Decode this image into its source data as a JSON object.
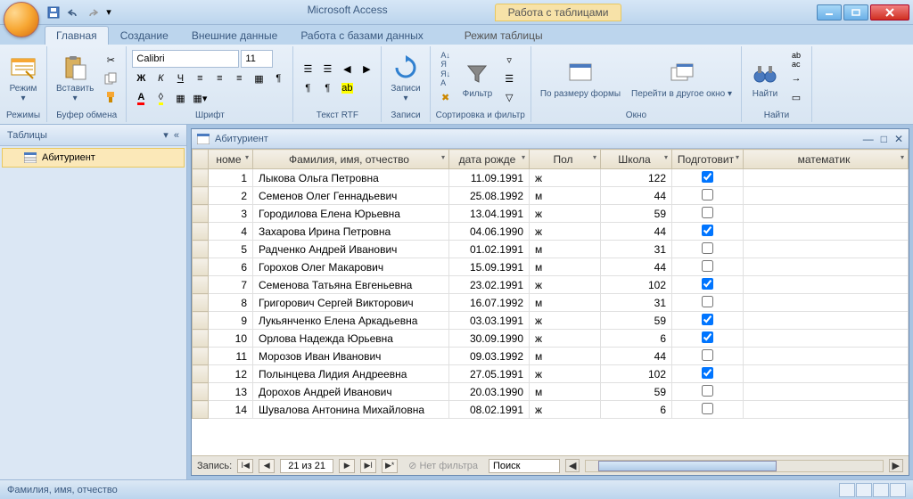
{
  "app": {
    "title": "Microsoft Access",
    "context_group": "Работа с таблицами"
  },
  "ribbon": {
    "tabs": [
      "Главная",
      "Создание",
      "Внешние данные",
      "Работа с базами данных"
    ],
    "context_tab": "Режим таблицы",
    "active": 0,
    "groups": {
      "views": {
        "label": "Режимы",
        "btn": "Режим"
      },
      "clipboard": {
        "label": "Буфер обмена",
        "paste": "Вставить"
      },
      "font": {
        "label": "Шрифт",
        "name": "Calibri",
        "size": "11"
      },
      "richtext": {
        "label": "Текст RTF"
      },
      "records": {
        "label": "Записи",
        "btn": "Записи"
      },
      "sortfilter": {
        "label": "Сортировка и фильтр",
        "filter": "Фильтр"
      },
      "window": {
        "label": "Окно",
        "fit": "По размеру формы",
        "switch": "Перейти в другое окно"
      },
      "find": {
        "label": "Найти",
        "btn": "Найти"
      }
    }
  },
  "nav": {
    "header": "Таблицы",
    "item": "Абитуриент"
  },
  "doc": {
    "title": "Абитуриент"
  },
  "columns": [
    "номе",
    "Фамилия, имя, отчество",
    "дата рожде",
    "Пол",
    "Школа",
    "Подготовит",
    "математик"
  ],
  "rows": [
    {
      "n": 1,
      "fio": "Лыкова Ольга Петровна",
      "dob": "11.09.1991",
      "sex": "ж",
      "school": 122,
      "prep": true
    },
    {
      "n": 2,
      "fio": "Семенов Олег Геннадьевич",
      "dob": "25.08.1992",
      "sex": "м",
      "school": 44,
      "prep": false
    },
    {
      "n": 3,
      "fio": "Городилова Елена Юрьевна",
      "dob": "13.04.1991",
      "sex": "ж",
      "school": 59,
      "prep": false
    },
    {
      "n": 4,
      "fio": "Захарова Ирина Петровна",
      "dob": "04.06.1990",
      "sex": "ж",
      "school": 44,
      "prep": true
    },
    {
      "n": 5,
      "fio": "Радченко Андрей Иванович",
      "dob": "01.02.1991",
      "sex": "м",
      "school": 31,
      "prep": false
    },
    {
      "n": 6,
      "fio": "Горохов Олег Макарович",
      "dob": "15.09.1991",
      "sex": "м",
      "school": 44,
      "prep": false
    },
    {
      "n": 7,
      "fio": "Семенова Татьяна Евгеньевна",
      "dob": "23.02.1991",
      "sex": "ж",
      "school": 102,
      "prep": true
    },
    {
      "n": 8,
      "fio": "Григорович Сергей Викторович",
      "dob": "16.07.1992",
      "sex": "м",
      "school": 31,
      "prep": false
    },
    {
      "n": 9,
      "fio": "Лукьянченко Елена Аркадьевна",
      "dob": "03.03.1991",
      "sex": "ж",
      "school": 59,
      "prep": true
    },
    {
      "n": 10,
      "fio": "Орлова Надежда Юрьевна",
      "dob": "30.09.1990",
      "sex": "ж",
      "school": 6,
      "prep": true
    },
    {
      "n": 11,
      "fio": "Морозов Иван Иванович",
      "dob": "09.03.1992",
      "sex": "м",
      "school": 44,
      "prep": false
    },
    {
      "n": 12,
      "fio": "Полынцева Лидия Андреевна",
      "dob": "27.05.1991",
      "sex": "ж",
      "school": 102,
      "prep": true
    },
    {
      "n": 13,
      "fio": "Дорохов Андрей Иванович",
      "dob": "20.03.1990",
      "sex": "м",
      "school": 59,
      "prep": false
    },
    {
      "n": 14,
      "fio": "Шувалова Антонина Михайловна",
      "dob": "08.02.1991",
      "sex": "ж",
      "school": 6,
      "prep": false
    }
  ],
  "recnav": {
    "label": "Запись:",
    "pos": "21 из 21",
    "nofilter": "Нет фильтра",
    "search": "Поиск"
  },
  "status": {
    "text": "Фамилия, имя, отчество"
  }
}
